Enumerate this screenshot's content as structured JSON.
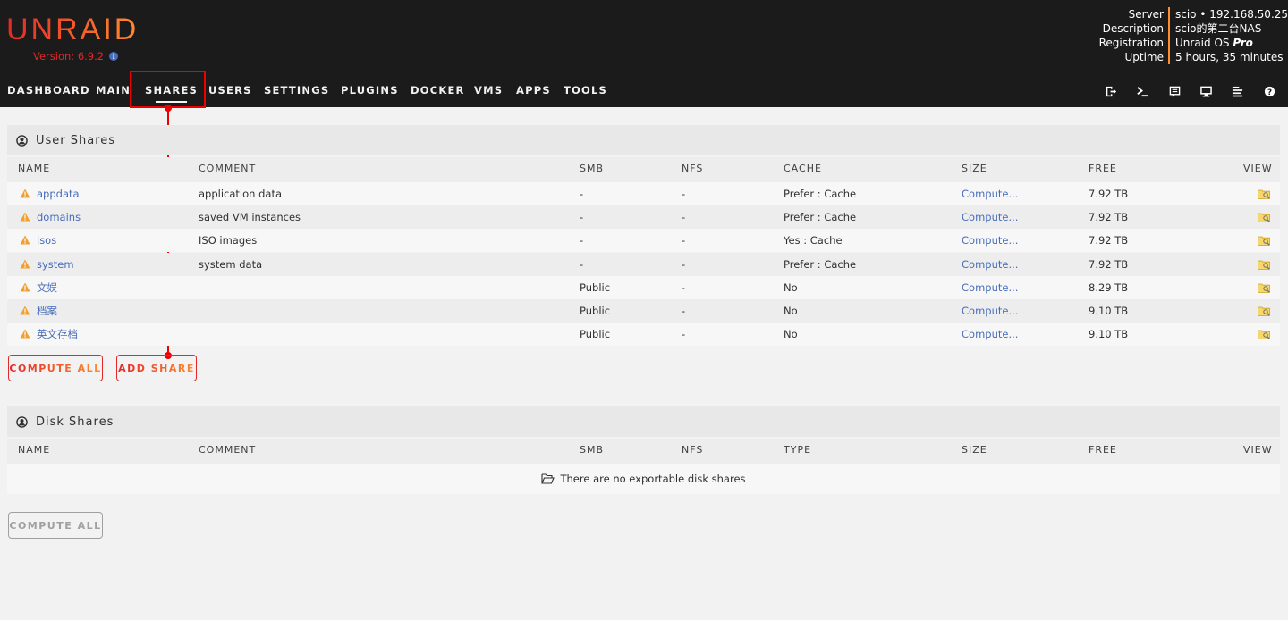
{
  "app": {
    "logo": "UNRAID",
    "version": "Version: 6.9.2"
  },
  "server_info": {
    "labels": [
      "Server",
      "Description",
      "Registration",
      "Uptime"
    ],
    "server": "scio • 192.168.50.25",
    "description": "scio的第二台NAS",
    "registration_prefix": "Unraid OS ",
    "registration_plan": "Pro",
    "uptime": "5 hours, 35 minutes"
  },
  "nav": {
    "items": [
      "DASHBOARD",
      "MAIN",
      "SHARES",
      "USERS",
      "SETTINGS",
      "PLUGINS",
      "DOCKER",
      "VMS",
      "APPS",
      "TOOLS"
    ],
    "active": "SHARES",
    "icons": [
      "logout-icon",
      "terminal-icon",
      "log-icon",
      "monitor-icon",
      "list-icon",
      "help-icon"
    ]
  },
  "user_shares": {
    "title": "User Shares",
    "columns": [
      "NAME",
      "COMMENT",
      "SMB",
      "NFS",
      "CACHE",
      "SIZE",
      "FREE",
      "VIEW"
    ],
    "rows": [
      {
        "name": "appdata",
        "comment": "application data",
        "smb": "-",
        "nfs": "-",
        "cache": "Prefer : Cache",
        "size": "Compute...",
        "free": "7.92 TB"
      },
      {
        "name": "domains",
        "comment": "saved VM instances",
        "smb": "-",
        "nfs": "-",
        "cache": "Prefer : Cache",
        "size": "Compute...",
        "free": "7.92 TB"
      },
      {
        "name": "isos",
        "comment": "ISO images",
        "smb": "-",
        "nfs": "-",
        "cache": "Yes : Cache",
        "size": "Compute...",
        "free": "7.92 TB"
      },
      {
        "name": "system",
        "comment": "system data",
        "smb": "-",
        "nfs": "-",
        "cache": "Prefer : Cache",
        "size": "Compute...",
        "free": "7.92 TB"
      },
      {
        "name": "文娱",
        "comment": "",
        "smb": "Public",
        "nfs": "-",
        "cache": "No",
        "size": "Compute...",
        "free": "8.29 TB"
      },
      {
        "name": "档案",
        "comment": "",
        "smb": "Public",
        "nfs": "-",
        "cache": "No",
        "size": "Compute...",
        "free": "9.10 TB"
      },
      {
        "name": "英文存档",
        "comment": "",
        "smb": "Public",
        "nfs": "-",
        "cache": "No",
        "size": "Compute...",
        "free": "9.10 TB"
      }
    ],
    "compute_all_label": "COMPUTE ALL",
    "add_share_label": "ADD SHARE"
  },
  "disk_shares": {
    "title": "Disk Shares",
    "columns": [
      "NAME",
      "COMMENT",
      "SMB",
      "NFS",
      "TYPE",
      "SIZE",
      "FREE",
      "VIEW"
    ],
    "empty_message": "There are no exportable disk shares",
    "compute_all_label": "COMPUTE ALL"
  },
  "colors": {
    "accent_red": "#e22828",
    "accent_orange": "#ff8c2f",
    "link_blue": "#486dba",
    "annotation_red": "#e00000"
  }
}
